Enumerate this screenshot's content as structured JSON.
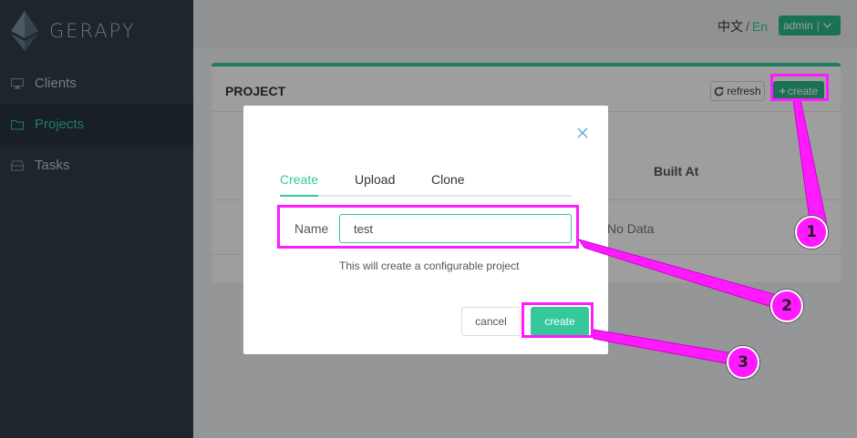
{
  "app": {
    "brand": "GERAPY"
  },
  "sidebar": {
    "items": [
      {
        "label": "Clients",
        "icon": "monitor-icon",
        "active": false
      },
      {
        "label": "Projects",
        "icon": "folder-icon",
        "active": true
      },
      {
        "label": "Tasks",
        "icon": "inbox-icon",
        "active": false
      }
    ]
  },
  "header": {
    "lang_zh": "中文",
    "lang_sep": "/",
    "lang_en": "En",
    "user_label": "admin"
  },
  "project_card": {
    "title": "PROJECT",
    "refresh_label": "refresh",
    "create_label": "create",
    "columns": [
      "Built At"
    ],
    "empty_text": "No Data"
  },
  "modal": {
    "tabs": [
      {
        "label": "Create",
        "active": true
      },
      {
        "label": "Upload",
        "active": false
      },
      {
        "label": "Clone",
        "active": false
      }
    ],
    "name_label": "Name",
    "name_value": "test",
    "hint": "This will create a configurable project",
    "cancel_label": "cancel",
    "create_label": "create"
  },
  "annotations": {
    "color": "#ff1aff",
    "steps": [
      "1",
      "2",
      "3"
    ]
  },
  "colors": {
    "accent": "#34c89b",
    "sidebar_bg": "#303d4a"
  }
}
